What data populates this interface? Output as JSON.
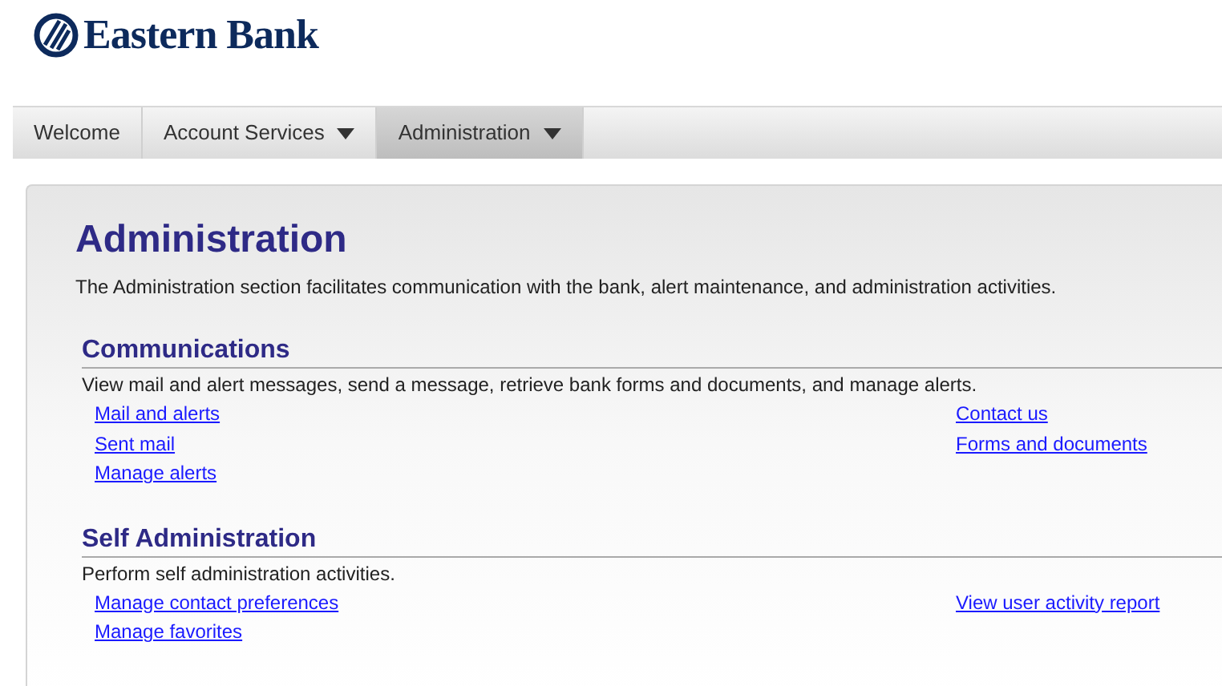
{
  "logo": {
    "text": "Eastern Bank"
  },
  "tabs": [
    {
      "label": "Welcome",
      "selected": false,
      "has_menu": false
    },
    {
      "label": "Account Services",
      "selected": false,
      "has_menu": true
    },
    {
      "label": "Administration",
      "selected": true,
      "has_menu": true
    }
  ],
  "page": {
    "title": "Administration",
    "description": "The Administration section facilitates communication with the bank, alert maintenance, and administration activities."
  },
  "sections": [
    {
      "title": "Communications",
      "description": "View mail and alert messages, send a message, retrieve bank forms and documents, and manage alerts.",
      "left_links": [
        "Mail and alerts",
        "Sent mail",
        "Manage alerts"
      ],
      "right_links": [
        "Contact us",
        "Forms and documents"
      ]
    },
    {
      "title": "Self Administration",
      "description": "Perform self administration activities.",
      "left_links": [
        "Manage contact preferences",
        "Manage favorites"
      ],
      "right_links": [
        "View user activity report"
      ]
    }
  ]
}
